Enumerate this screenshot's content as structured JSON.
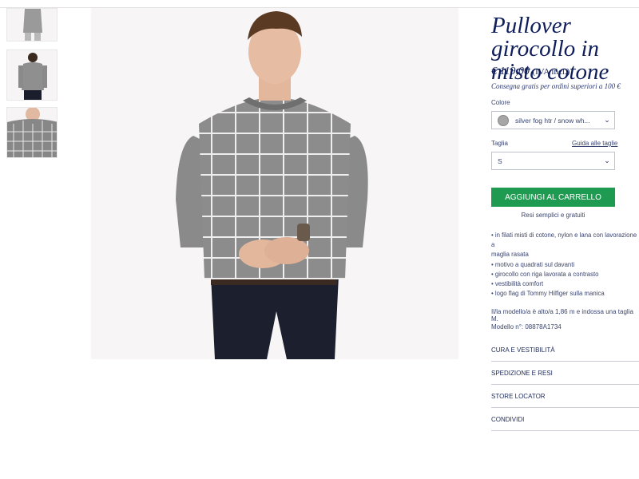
{
  "product": {
    "title": "Pullover girocollo in misto cotone",
    "price": "€ 119,00",
    "vat_note": "(IVA incl.)",
    "shipping_note": "Consegna gratis per ordini superiori a 100 €"
  },
  "color": {
    "label": "Colore",
    "selected": "silver fog htr / snow wh..."
  },
  "size": {
    "label": "Taglia",
    "guide_link": "Guida alle taglie",
    "selected": "S"
  },
  "cart": {
    "button_label": "AGGIUNGI AL CARRELLO",
    "returns_note": "Resi semplici e gratuiti"
  },
  "features": [
    "• in filati misti di cotone, nylon e lana con lavorazione a",
    "maglia rasata",
    "• motivo a quadrati sul davanti",
    "• girocollo con riga lavorata a contrasto",
    "• vestibilità comfort",
    "• logo flag di Tommy Hilfiger sulla manica"
  ],
  "model_info": "Il/la modello/a è alto/a 1,86 m e indossa una taglia M.",
  "model_code": "Modello n°: 08878A1734",
  "accordion": [
    "CURA E VESTIBILITÀ",
    "SPEDIZIONE E RESI",
    "STORE LOCATOR",
    "CONDIVIDI"
  ],
  "colors": {
    "navy": "#0f1e5a",
    "cta_green": "#1f9a51",
    "sweater_grey": "#8c8c8c"
  },
  "icons": [
    "chevron-down-icon",
    "color-swatch-icon"
  ]
}
